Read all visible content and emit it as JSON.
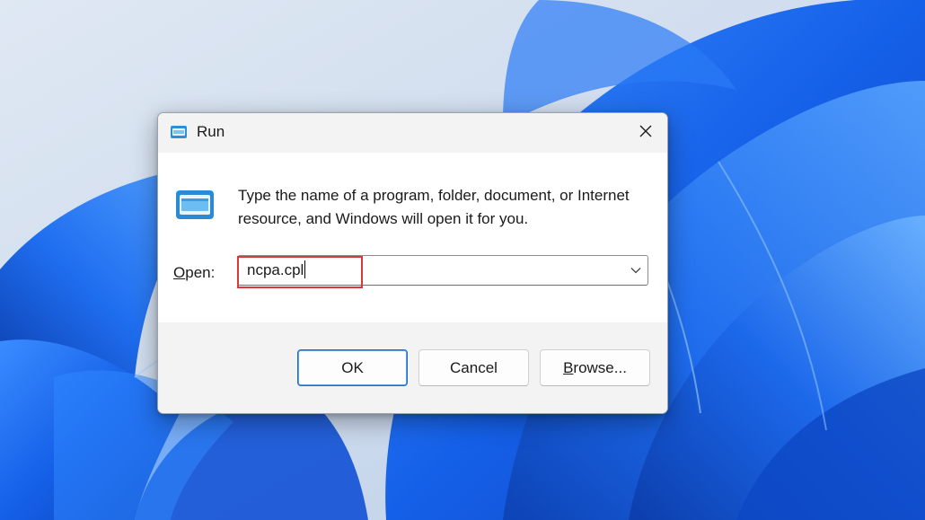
{
  "desktop": {
    "wallpaper": "windows-11-bloom"
  },
  "dialog": {
    "title": "Run",
    "title_icon": "run-icon",
    "close_icon": "close-icon",
    "description": "Type the name of a program, folder, document, or Internet resource, and Windows will open it for you.",
    "open_label_first": "O",
    "open_label_rest": "pen:",
    "open_value": "ncpa.cpl",
    "dropdown_icon": "chevron-down-icon",
    "ok_label": "OK",
    "cancel_label": "Cancel",
    "browse_label_first": "B",
    "browse_label_rest": "rowse..."
  },
  "colors": {
    "accent": "#1c6cc2",
    "highlight": "#d9393b",
    "titlebar": "#f3f3f3"
  }
}
